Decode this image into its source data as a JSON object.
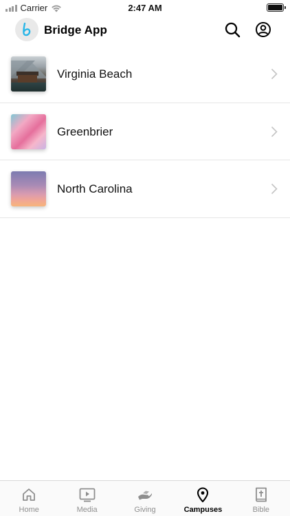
{
  "status_bar": {
    "carrier": "Carrier",
    "time": "2:47 AM"
  },
  "header": {
    "title": "Bridge App",
    "logo_letter": "b",
    "logo_color": "#29b6e8",
    "icons": [
      "search-icon",
      "profile-icon"
    ]
  },
  "campuses": [
    {
      "name": "Virginia Beach",
      "thumb": "mountain-lake-cabin"
    },
    {
      "name": "Greenbrier",
      "thumb": "pink-abstract"
    },
    {
      "name": "North Carolina",
      "thumb": "sunset-sky"
    }
  ],
  "tab_bar": {
    "active": "Campuses",
    "tabs": [
      {
        "label": "Home",
        "icon": "home-icon"
      },
      {
        "label": "Media",
        "icon": "play-icon"
      },
      {
        "label": "Giving",
        "icon": "giving-hand-icon"
      },
      {
        "label": "Campuses",
        "icon": "location-pin-icon"
      },
      {
        "label": "Bible",
        "icon": "bible-icon"
      }
    ]
  }
}
